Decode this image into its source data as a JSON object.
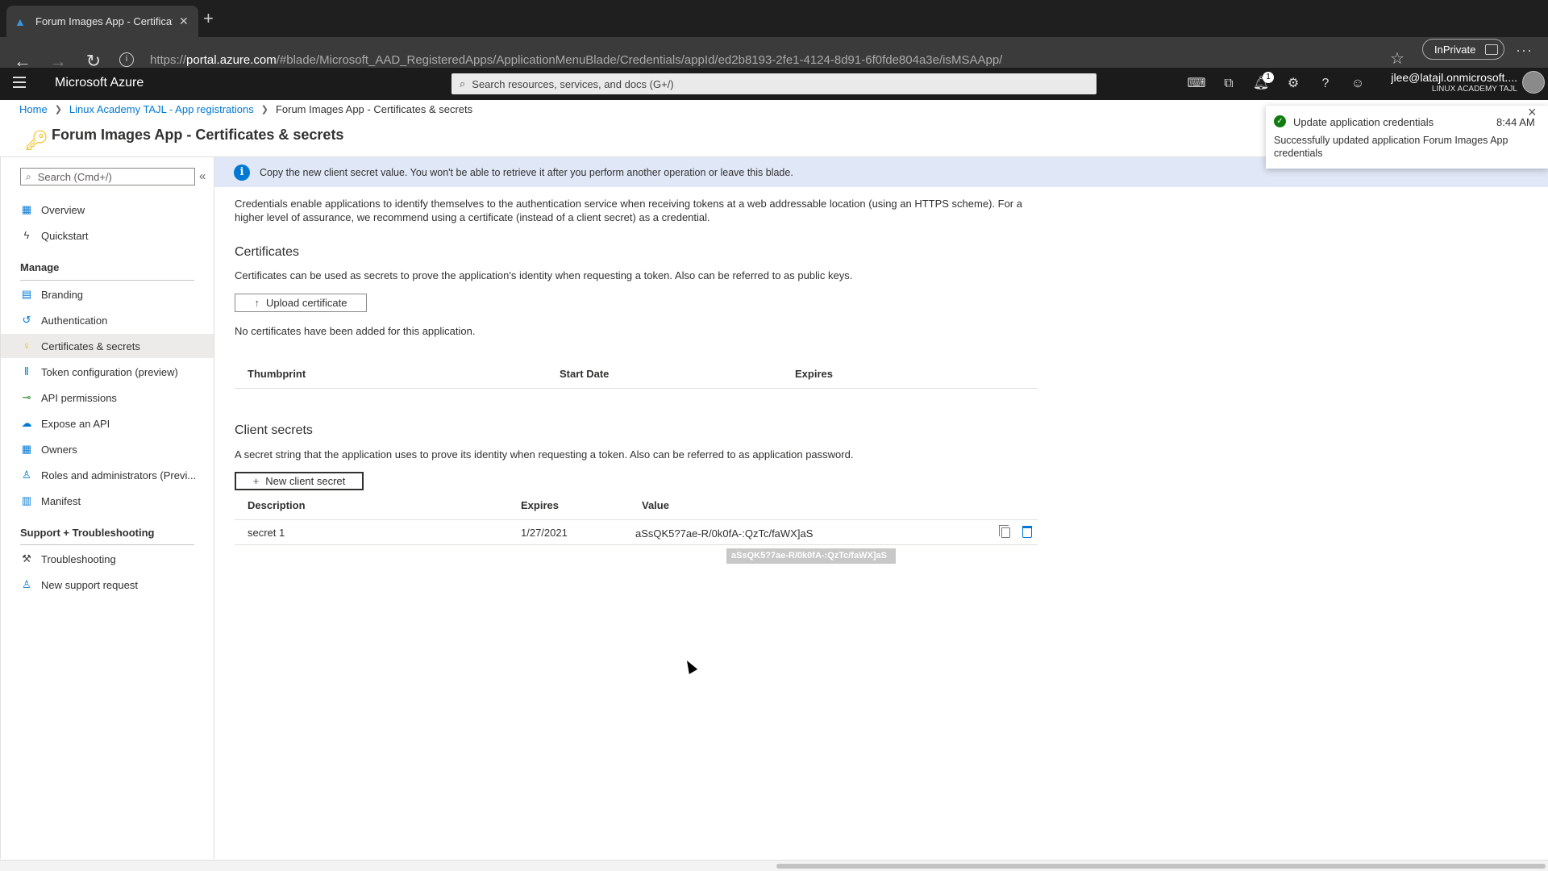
{
  "browser": {
    "tab_title": "Forum Images App - Certificates & secrets",
    "new_tab": "+",
    "url_prefix": "https://",
    "url_host": "portal.azure.com",
    "url_path": "/#blade/Microsoft_AAD_RegisteredApps/ApplicationMenuBlade/Credentials/appId/ed2b8193-2fe1-4124-8d91-6f0fde804a3e/isMSAApp/",
    "inprivate": "InPrivate"
  },
  "azure": {
    "title": "Microsoft Azure",
    "search_placeholder": "Search resources, services, and docs (G+/)",
    "notification_count": "1",
    "user_email": "jlee@latajl.onmicrosoft....",
    "user_org": "LINUX ACADEMY TAJL"
  },
  "breadcrumb": {
    "home": "Home",
    "app_registrations": "Linux Academy TAJL - App registrations",
    "current": "Forum Images App - Certificates & secrets"
  },
  "page_title": "Forum Images App - Certificates & secrets",
  "sidebar": {
    "search_placeholder": "Search (Cmd+/)",
    "top_items": [
      {
        "label": "Overview"
      },
      {
        "label": "Quickstart"
      }
    ],
    "manage_header": "Manage",
    "manage_items": [
      {
        "label": "Branding"
      },
      {
        "label": "Authentication"
      },
      {
        "label": "Certificates & secrets"
      },
      {
        "label": "Token configuration (preview)"
      },
      {
        "label": "API permissions"
      },
      {
        "label": "Expose an API"
      },
      {
        "label": "Owners"
      },
      {
        "label": "Roles and administrators (Previ..."
      },
      {
        "label": "Manifest"
      }
    ],
    "support_header": "Support + Troubleshooting",
    "support_items": [
      {
        "label": "Troubleshooting"
      },
      {
        "label": "New support request"
      }
    ]
  },
  "banner": "Copy the new client secret value. You won't be able to retrieve it after you perform another operation or leave this blade.",
  "intro_line1": "Credentials enable applications to identify themselves to the authentication service when receiving tokens at a web addressable location (using an HTTPS scheme). For a",
  "intro_line2": "higher level of assurance, we recommend using a certificate (instead of a client secret) as a credential.",
  "certificates": {
    "heading": "Certificates",
    "description": "Certificates can be used as secrets to prove the application's identity when requesting a token. Also can be referred to as public keys.",
    "upload_button": "Upload certificate",
    "empty_message": "No certificates have been added for this application.",
    "columns": [
      "Thumbprint",
      "Start Date",
      "Expires"
    ]
  },
  "client_secrets": {
    "heading": "Client secrets",
    "description": "A secret string that the application uses to prove its identity when requesting a token. Also can be referred to as application password.",
    "new_button": "New client secret",
    "columns": [
      "Description",
      "Expires",
      "Value"
    ],
    "rows": [
      {
        "description": "secret 1",
        "expires": "1/27/2021",
        "value": "aSsQK5?7ae-R/0k0fA-:QzTc/faWX]aS"
      }
    ],
    "tooltip": "aSsQK5?7ae-R/0k0fA-:QzTc/faWX]aS"
  },
  "toast": {
    "title": "Update application credentials",
    "time": "8:44 AM",
    "message": "Successfully updated application Forum Images App credentials"
  },
  "colors": {
    "accent": "#0078d4",
    "banner_bg": "#e0e8f7",
    "success": "#107c10"
  }
}
